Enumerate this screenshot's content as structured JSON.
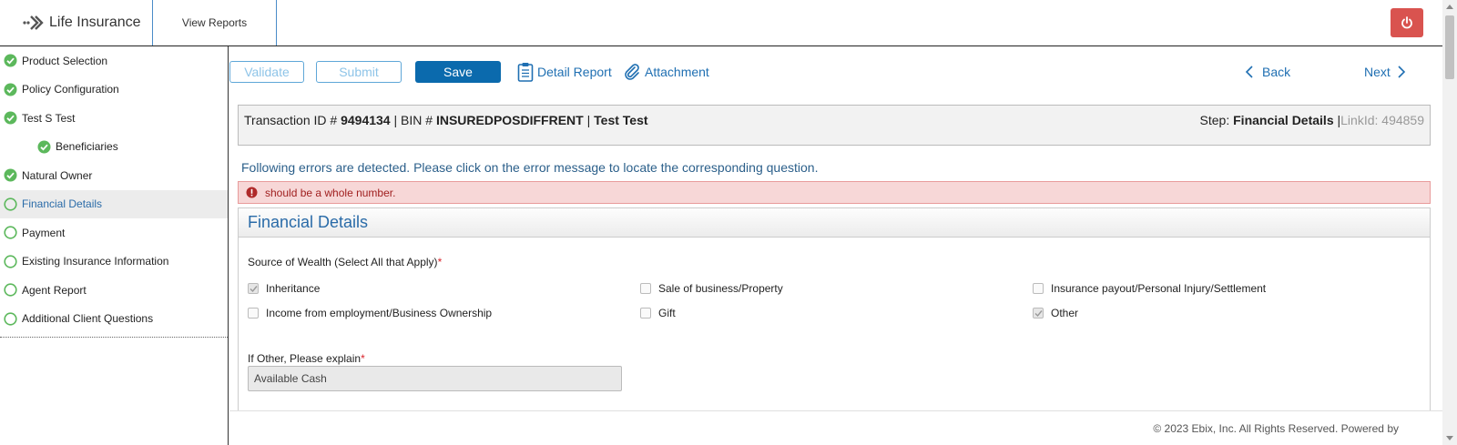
{
  "header": {
    "app_title": "Life Insurance",
    "nav_reports": "View Reports",
    "power_icon": "power-icon"
  },
  "sidebar": {
    "items": [
      {
        "label": "Product Selection",
        "status": "complete"
      },
      {
        "label": "Policy Configuration",
        "status": "complete"
      },
      {
        "label": "Test S Test",
        "status": "complete"
      },
      {
        "label": "Beneficiaries",
        "status": "complete"
      },
      {
        "label": "Natural Owner",
        "status": "complete"
      },
      {
        "label": "Financial Details",
        "status": "active"
      },
      {
        "label": "Payment",
        "status": "pending"
      },
      {
        "label": "Existing Insurance Information",
        "status": "pending"
      },
      {
        "label": "Agent Report",
        "status": "pending"
      },
      {
        "label": "Additional Client Questions",
        "status": "pending"
      }
    ]
  },
  "toolbar": {
    "validate": "Validate",
    "submit": "Submit",
    "save": "Save",
    "detail_report": "Detail Report",
    "attachment": "Attachment",
    "back": "Back",
    "next": "Next"
  },
  "transaction": {
    "id_label": "Transaction ID #",
    "id_value": "9494134",
    "bin_label": "| BIN #",
    "bin_value": "INSUREDPOSDIFFRENT",
    "separator": "|",
    "name": "Test Test",
    "step_label": "Step:",
    "step_value": "Financial Details",
    "link_sep": "|",
    "link_label": "LinkId: 494859"
  },
  "errors": {
    "message": "Following errors are detected. Please click on the error message to locate the corresponding question.",
    "items": [
      "should be a whole number."
    ]
  },
  "panel": {
    "title": "Financial Details",
    "wealth_label": "Source of Wealth (Select All that Apply)",
    "required_mark": "*",
    "options": [
      {
        "label": "Inheritance",
        "checked": true
      },
      {
        "label": "Sale of business/Property",
        "checked": false
      },
      {
        "label": "Insurance payout/Personal Injury/Settlement",
        "checked": false
      },
      {
        "label": "Income from employment/Business Ownership",
        "checked": false
      },
      {
        "label": "Gift",
        "checked": false
      },
      {
        "label": "Other",
        "checked": true
      }
    ],
    "other_label": "If Other, Please explain",
    "other_value": "Available Cash"
  },
  "footer": {
    "copyright": "© 2023 Ebix, Inc. All Rights Reserved. Powered by"
  },
  "colors": {
    "accent": "#0b6aad",
    "success": "#5cb85c",
    "danger": "#d9534f",
    "link": "#1f6fb2"
  }
}
